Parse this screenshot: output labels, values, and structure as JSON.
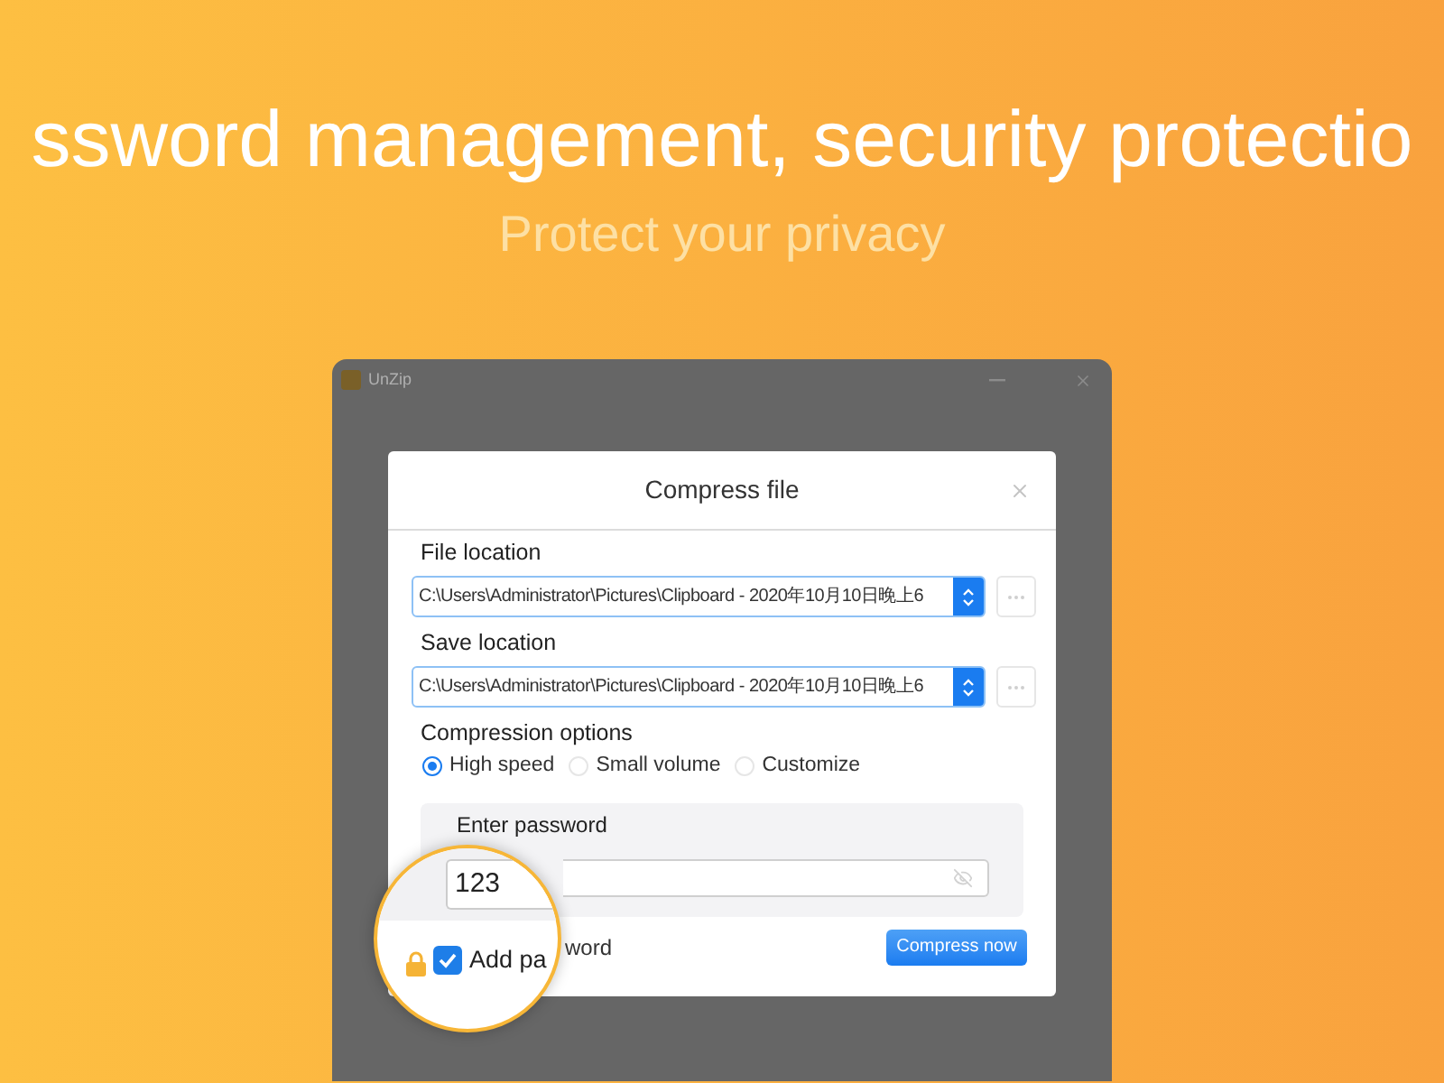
{
  "headline": "ssword management, security protectio",
  "subheadline": "Protect your privacy",
  "app_window": {
    "title": "UnZip"
  },
  "dialog": {
    "title": "Compress file",
    "location_fields": [
      {
        "label": "File location",
        "value": "C:\\Users\\Administrator\\Pictures\\Clipboard - 2020年10月10日晚上6"
      },
      {
        "label": "Save location",
        "value": "C:\\Users\\Administrator\\Pictures\\Clipboard - 2020年10月10日晚上6"
      }
    ],
    "compression_options": {
      "label": "Compression options",
      "options": [
        {
          "label": "High speed",
          "selected": true
        },
        {
          "label": "Small volume",
          "selected": false
        },
        {
          "label": "Customize",
          "selected": false
        }
      ]
    },
    "password_panel": {
      "label": "Enter password"
    },
    "add_password_label": "word",
    "compress_button": "Compress now"
  },
  "magnifier": {
    "password_value": "123",
    "add_password": {
      "checked": true,
      "label": "Add pa"
    }
  }
}
